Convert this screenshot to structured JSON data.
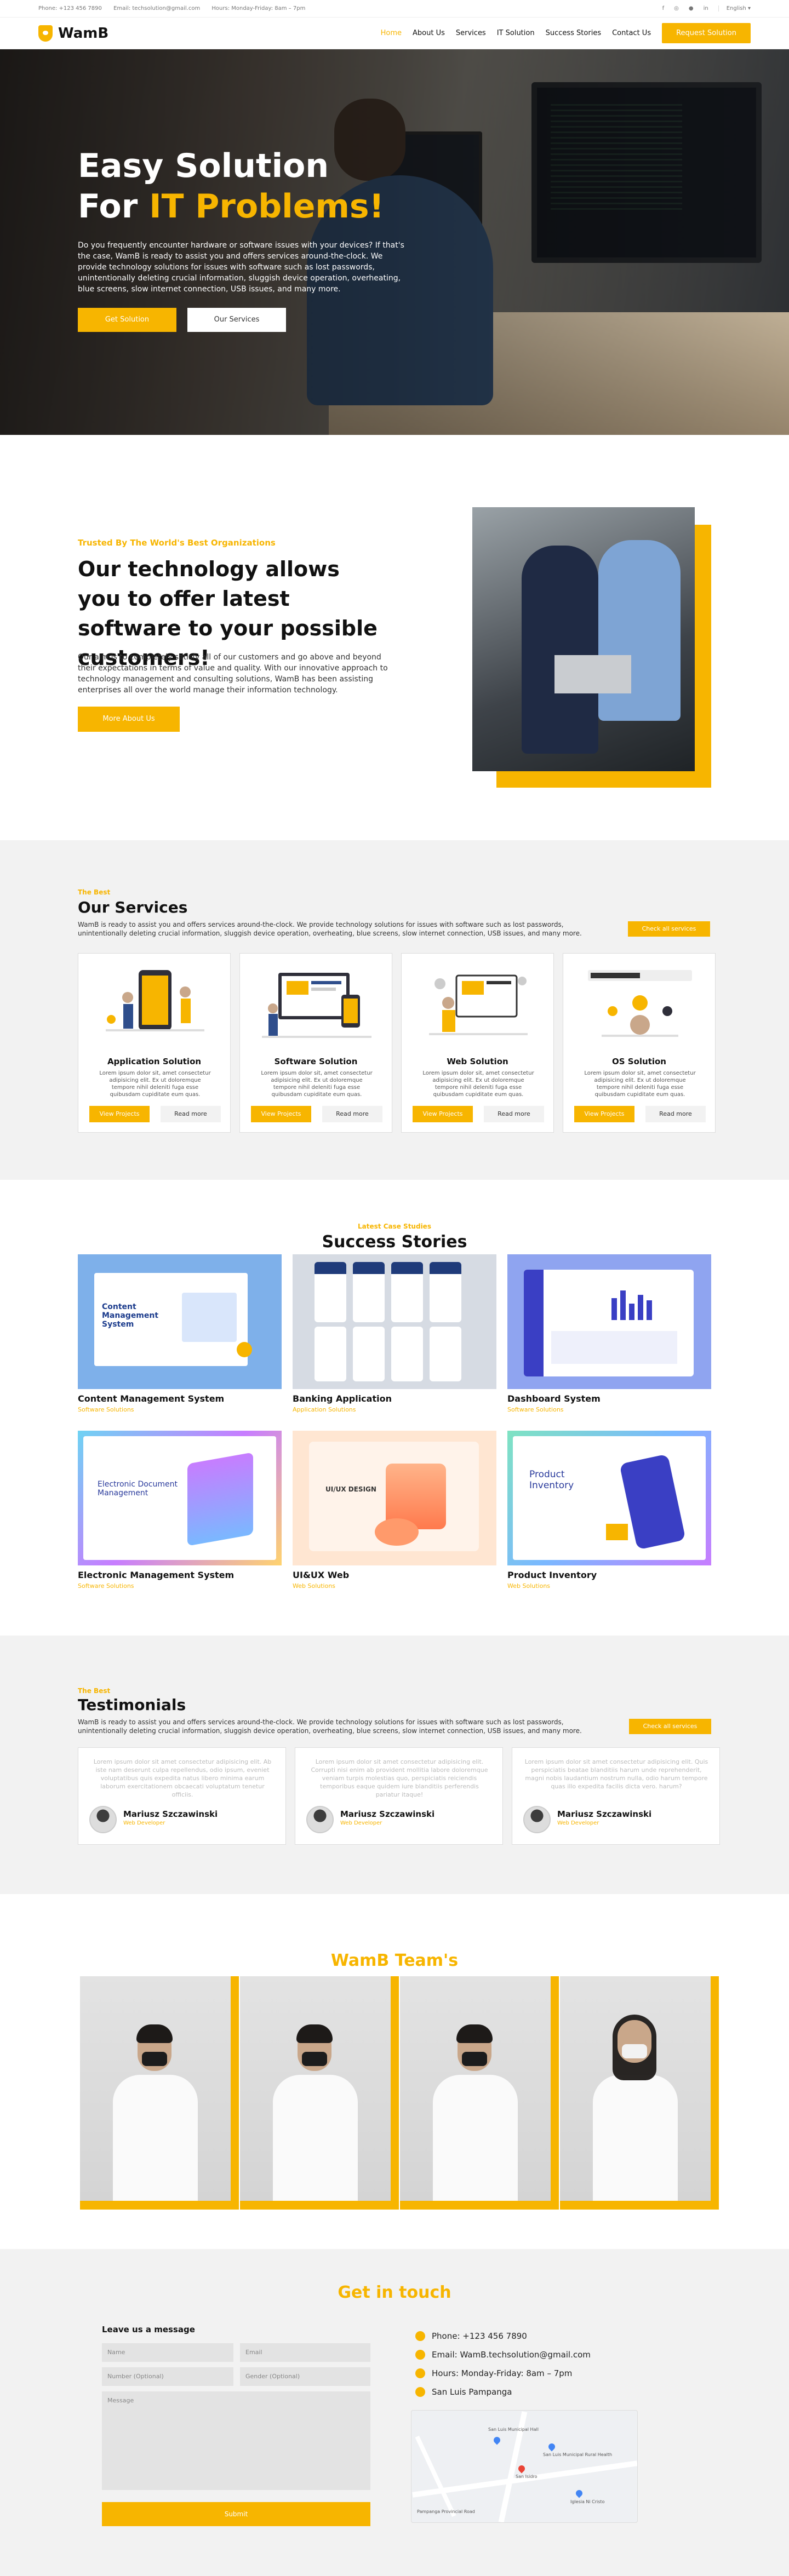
{
  "colors": {
    "accent": "#f7b500",
    "section_bg": "#f2f2f2"
  },
  "topbar": {
    "phone": "Phone: +123 456 7890",
    "email": "Email: techsolution@gmail.com",
    "hours": "Hours: Monday-Friday: 8am – 7pm",
    "social_icons": [
      "facebook-icon",
      "instagram-icon",
      "github-icon",
      "linkedin-icon"
    ],
    "language": "English"
  },
  "nav": {
    "brand": "WamB",
    "items": [
      "Home",
      "About Us",
      "Services",
      "IT Solution",
      "Success Stories",
      "Contact Us"
    ],
    "active": "Home",
    "cta": "Request Solution"
  },
  "hero": {
    "line1": "Easy Solution",
    "line2_prefix": "For ",
    "line2_highlight": "IT Problems!",
    "text": "Do you frequently encounter hardware or software issues with your devices? If that's the case, WamB is ready to assist you and offers services around-the-clock. We provide technology solutions for issues with software such as lost passwords, unintentionally deleting crucial information, sluggish device operation, overheating, blue screens, slow internet connection, USB issues, and many more.",
    "btn_primary": "Get Solution",
    "btn_secondary": "Our Services"
  },
  "about": {
    "kicker": "Trusted By The World's Best Organizations",
    "heading": "Our technology allows you to offer latest software to your possible customers!",
    "text": "Our aim is to completely satisfy all of our customers and go above and beyond their expectations in terms of value and quality. With our innovative approach to technology management and consulting solutions, WamB has been assisting enterprises all over the world manage their information technology.",
    "button": "More About Us"
  },
  "services": {
    "kicker": "The Best",
    "title": "Our Services",
    "desc": "WamB is ready to assist you and offers services around-the-clock. We provide technology solutions for issues with software such as lost passwords, unintentionally deleting crucial information, sluggish device operation, overheating, blue screens, slow internet connection, USB issues, and many more.",
    "all_button": "Check all services",
    "cards": [
      {
        "title": "Application Solution",
        "text": "Lorem ipsum dolor sit, amet consectetur adipisicing elit. Ex ut doloremque tempore nihil deleniti fuga esse quibusdam cupiditate eum quas.",
        "btn": "View Projects",
        "more": "Read more"
      },
      {
        "title": "Software Solution",
        "text": "Lorem ipsum dolor sit, amet consectetur adipisicing elit. Ex ut doloremque tempore nihil deleniti fuga esse quibusdam cupiditate eum quas.",
        "btn": "View Projects",
        "more": "Read more"
      },
      {
        "title": "Web Solution",
        "text": "Lorem ipsum dolor sit, amet consectetur adipisicing elit. Ex ut doloremque tempore nihil deleniti fuga esse quibusdam cupiditate eum quas.",
        "btn": "View Projects",
        "more": "Read more"
      },
      {
        "title": "OS Solution",
        "text": "Lorem ipsum dolor sit, amet consectetur adipisicing elit. Ex ut doloremque tempore nihil deleniti fuga esse quibusdam cupiditate eum quas.",
        "btn": "View Projects",
        "more": "Read more"
      }
    ]
  },
  "stories": {
    "kicker": "Latest Case Studies",
    "title": "Success Stories",
    "items": [
      {
        "title": "Content Management System",
        "category": "Software Solutions",
        "img_text": "Content Management System"
      },
      {
        "title": "Banking Application",
        "category": "Application Solutions",
        "img_text": ""
      },
      {
        "title": "Dashboard System",
        "category": "Software Solutions",
        "img_text": ""
      },
      {
        "title": "Electronic Management System",
        "category": "Software Solutions",
        "img_text": "Electronic Document Management"
      },
      {
        "title": "UI&UX Web",
        "category": "Web Solutions",
        "img_text": "UI/UX DESIGN"
      },
      {
        "title": "Product Inventory",
        "category": "Web Solutions",
        "img_text": "Product Inventory"
      }
    ]
  },
  "testimonials": {
    "kicker": "The Best",
    "title": "Testimonials",
    "desc": "WamB is ready to assist you and offers services around-the-clock. We provide technology solutions for issues with software such as lost passwords, unintentionally deleting crucial information, sluggish device operation, overheating, blue screens, slow internet connection, USB issues, and many more.",
    "all_button": "Check all services",
    "items": [
      {
        "quote": "Lorem ipsum dolor sit amet consectetur adipisicing elit. Ab iste nam deserunt culpa repellendus, odio ipsum, eveniet voluptatibus quis expedita natus libero minima earum laborum exercitationem obcaecati voluptatum tenetur officiis.",
        "name": "Mariusz Szczawinski",
        "role": "Web Developer"
      },
      {
        "quote": "Lorem ipsum dolor sit amet consectetur adipisicing elit. Corrupti nisi enim ab provident mollitia labore doloremque veniam turpis molestias quo, perspiciatis reiciendis temporibus eaque quidem iure blanditiis perferendis pariatur itaque!",
        "name": "Mariusz Szczawinski",
        "role": "Web Developer"
      },
      {
        "quote": "Lorem ipsum dolor sit amet consectetur adipisicing elit. Quis perspiciatis beatae blanditiis harum unde reprehenderit, magni nobis laudantium nostrum nulla, odio harum tempore quas illo expedita facilis dicta vero. harum?",
        "name": "Mariusz Szczawinski",
        "role": "Web Developer"
      }
    ]
  },
  "team": {
    "title": "WamB Team's",
    "members": 4
  },
  "contact": {
    "title": "Get in touch",
    "form_title": "Leave us a message",
    "name_ph": "Name",
    "email_ph": "Email",
    "number_ph": "Number (Optional)",
    "gender_ph": "Gender (Optional)",
    "message_ph": "Message",
    "submit": "Submit",
    "phone": "Phone: +123 456 7890",
    "email": "Email: WamB.techsolution@gmail.com",
    "hours": "Hours: Monday-Friday: 8am – 7pm",
    "location": "San Luis Pampanga",
    "map_labels": [
      "San Luis Municipal Hall",
      "San Luis Municipal Rural Health",
      "San Isidro",
      "Iglesia Ni Cristo",
      "Pampanga Provincial Road"
    ]
  }
}
